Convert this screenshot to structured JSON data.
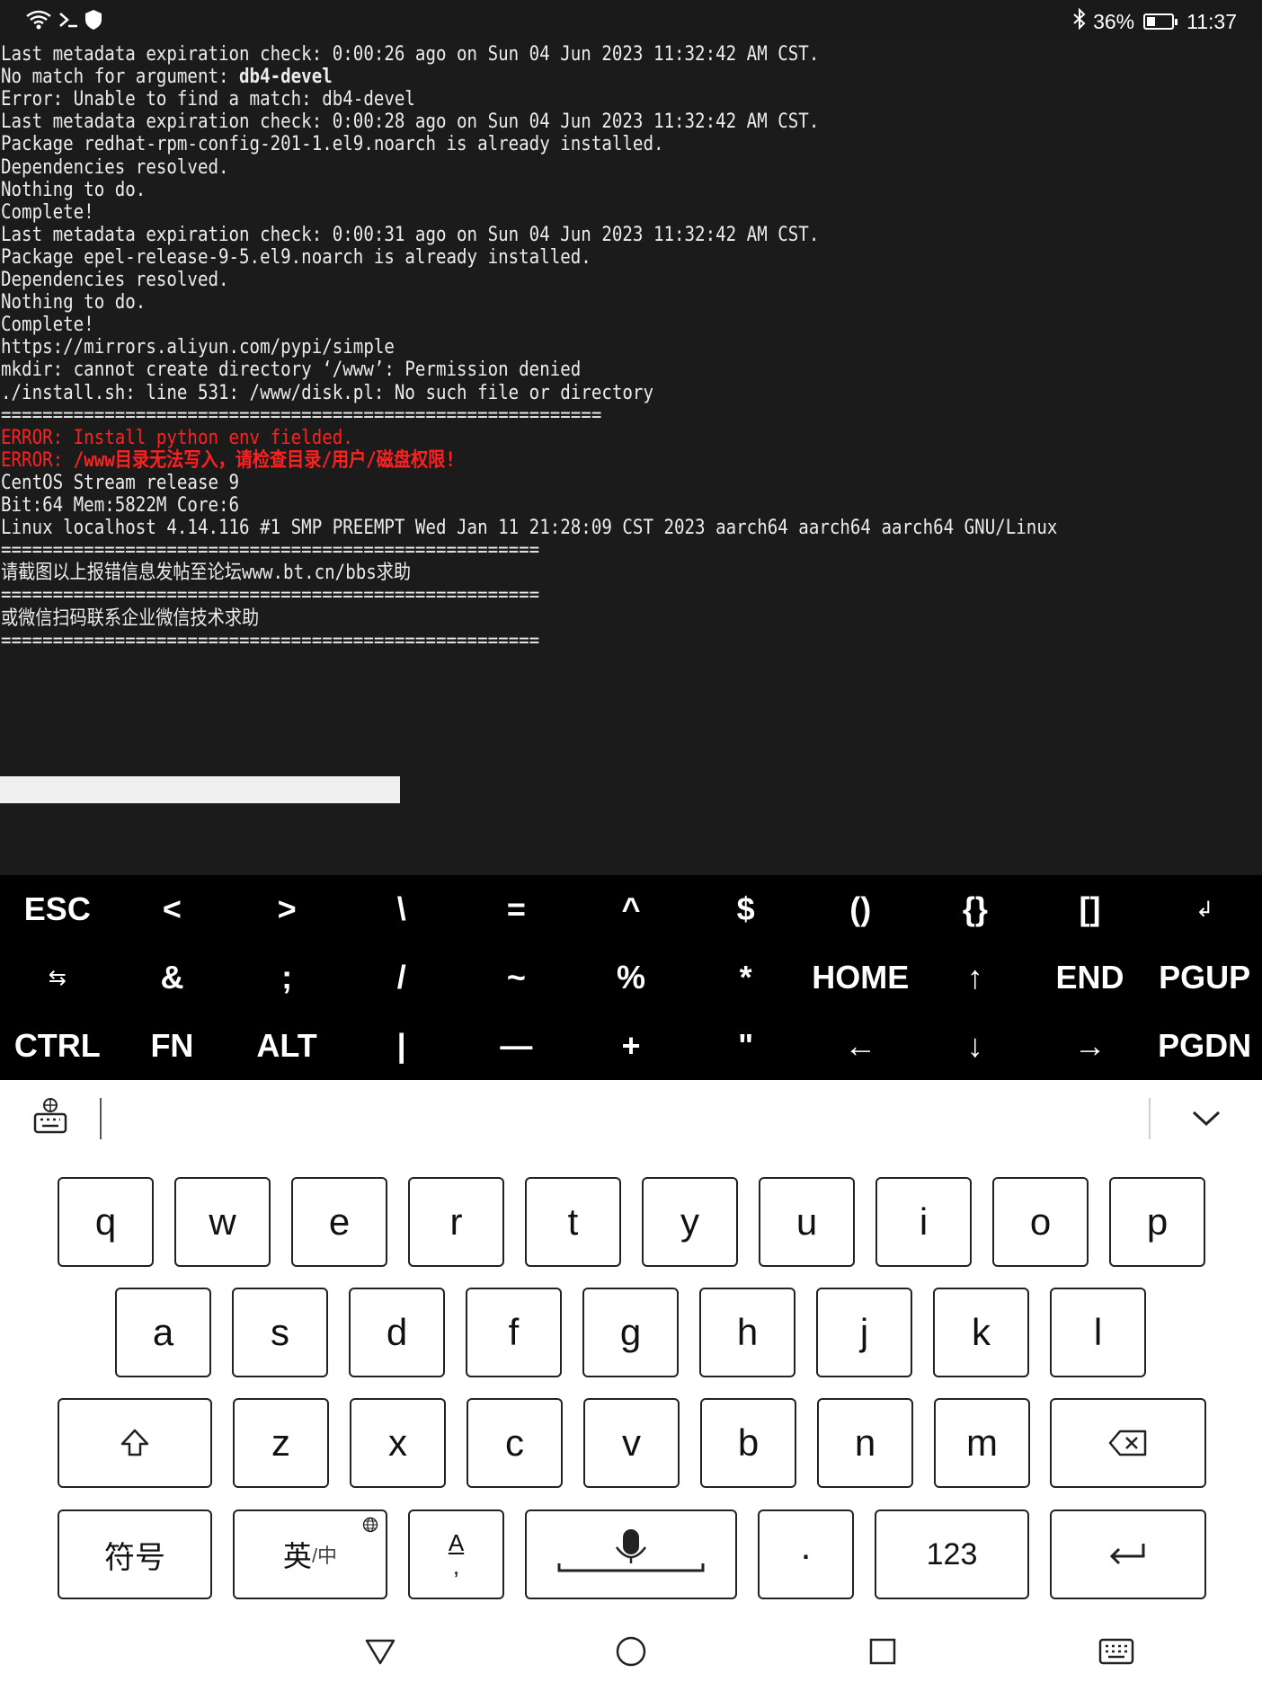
{
  "status_bar": {
    "left_icons": [
      "wifi-icon",
      "terminal-icon",
      "shield-icon"
    ],
    "bluetooth_icon": "bluetooth-icon",
    "battery_percent": "36%",
    "battery_level": 0.36,
    "time": "11:37"
  },
  "terminal": {
    "lines": [
      {
        "text": "Last metadata expiration check: 0:00:26 ago on Sun 04 Jun 2023 11:32:42 AM CST."
      },
      {
        "prefix": "No match for argument: ",
        "bold": "db4-devel"
      },
      {
        "text": "Error: Unable to find a match: db4-devel"
      },
      {
        "text": "Last metadata expiration check: 0:00:28 ago on Sun 04 Jun 2023 11:32:42 AM CST."
      },
      {
        "text": "Package redhat-rpm-config-201-1.el9.noarch is already installed."
      },
      {
        "text": "Dependencies resolved."
      },
      {
        "text": "Nothing to do."
      },
      {
        "text": "Complete!"
      },
      {
        "text": "Last metadata expiration check: 0:00:31 ago on Sun 04 Jun 2023 11:32:42 AM CST."
      },
      {
        "text": "Package epel-release-9-5.el9.noarch is already installed."
      },
      {
        "text": "Dependencies resolved."
      },
      {
        "text": "Nothing to do."
      },
      {
        "text": "Complete!"
      },
      {
        "text": "https://mirrors.aliyun.com/pypi/simple"
      },
      {
        "text": "mkdir: cannot create directory ‘/www’: Permission denied"
      },
      {
        "text": "./install.sh: line 531: /www/disk.pl: No such file or directory"
      },
      {
        "text": "=========================================================="
      },
      {
        "text": "ERROR: Install python env fielded.",
        "error": true
      },
      {
        "prefix": "ERROR: ",
        "bold": "/www目录无法写入，请检查目录/用户/磁盘权限!",
        "error": true
      },
      {
        "text": "CentOS Stream release 9"
      },
      {
        "text": "Bit:64 Mem:5822M Core:6"
      },
      {
        "text": "Linux localhost 4.14.116 #1 SMP PREEMPT Wed Jan 11 21:28:09 CST 2023 aarch64 aarch64 aarch64 GNU/Linux"
      },
      {
        "text": "===================================================="
      },
      {
        "text": "请截图以上报错信息发帖至论坛www.bt.cn/bbs求助"
      },
      {
        "text": "===================================================="
      },
      {
        "text": "或微信扫码联系企业微信技术求助"
      },
      {
        "text": "===================================================="
      }
    ]
  },
  "extra_keys": [
    [
      "ESC",
      "<",
      ">",
      "\\",
      "=",
      "^",
      "$",
      "()",
      "{}",
      "[]",
      "↲"
    ],
    [
      "⇆",
      "&",
      ";",
      "/",
      "~",
      "%",
      "*",
      "HOME",
      "↑",
      "END",
      "PGUP"
    ],
    [
      "CTRL",
      "FN",
      "ALT",
      "|",
      "—",
      "+",
      "\"",
      "←",
      "↓",
      "→",
      "PGDN"
    ]
  ],
  "ime": {
    "keyboard_settings_icon": "keyboard-settings-icon",
    "collapse_icon": "chevron-down-icon",
    "rows": [
      [
        "q",
        "w",
        "e",
        "r",
        "t",
        "y",
        "u",
        "i",
        "o",
        "p"
      ],
      [
        "a",
        "s",
        "d",
        "f",
        "g",
        "h",
        "j",
        "k",
        "l"
      ],
      [
        "z",
        "x",
        "c",
        "v",
        "b",
        "n",
        "m"
      ]
    ],
    "shift_icon": "shift-icon",
    "backspace_icon": "backspace-icon",
    "symbols_label": "符号",
    "lang_main": "英",
    "lang_sub": "/中",
    "lang_globe_icon": "globe-icon",
    "punct_top": "A",
    "punct_bottom": ",",
    "space_icon": "microphone-icon",
    "period_label": "·",
    "numbers_label": "123",
    "enter_icon": "enter-icon"
  },
  "nav_bar": {
    "back_icon": "back-triangle-icon",
    "home_icon": "home-circle-icon",
    "recents_icon": "recents-square-icon",
    "keyboard_icon": "keyboard-icon"
  }
}
